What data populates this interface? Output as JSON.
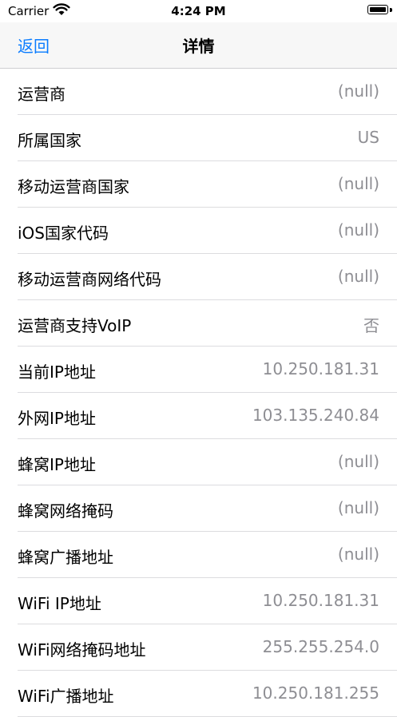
{
  "status_bar": {
    "carrier": "Carrier",
    "time": "4:24 PM"
  },
  "nav": {
    "back_label": "返回",
    "title": "详情",
    "accent_color": "#0a7cff"
  },
  "rows": [
    {
      "label": "运营商",
      "value": "(null)"
    },
    {
      "label": "所属国家",
      "value": "US"
    },
    {
      "label": "移动运营商国家",
      "value": "(null)"
    },
    {
      "label": "iOS国家代码",
      "value": "(null)"
    },
    {
      "label": "移动运营商网络代码",
      "value": "(null)"
    },
    {
      "label": "运营商支持VoIP",
      "value": "否"
    },
    {
      "label": "当前IP地址",
      "value": "10.250.181.31"
    },
    {
      "label": "外网IP地址",
      "value": "103.135.240.84"
    },
    {
      "label": "蜂窝IP地址",
      "value": "(null)"
    },
    {
      "label": "蜂窝网络掩码",
      "value": "(null)"
    },
    {
      "label": "蜂窝广播地址",
      "value": "(null)"
    },
    {
      "label": "WiFi IP地址",
      "value": "10.250.181.31"
    },
    {
      "label": "WiFi网络掩码地址",
      "value": "255.255.254.0"
    },
    {
      "label": "WiFi广播地址",
      "value": "10.250.181.255"
    }
  ]
}
